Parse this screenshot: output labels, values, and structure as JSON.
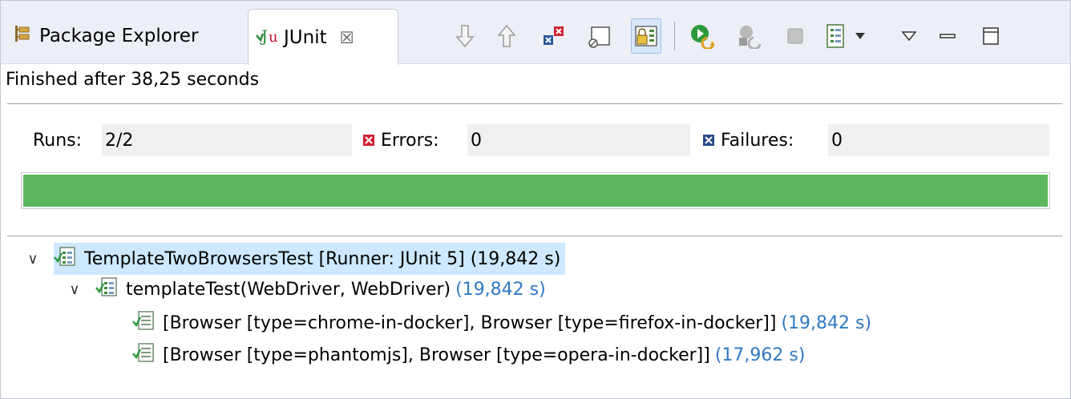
{
  "tabs": {
    "package_explorer": "Package Explorer",
    "junit": "JUnit"
  },
  "toolbar": {
    "icons": [
      "next-failure-icon",
      "previous-failure-icon",
      "show-failures-only-icon",
      "show-skipped-tests-only-icon",
      "scroll-lock-icon",
      "rerun-test-icon",
      "rerun-failed-first-icon",
      "stop-icon",
      "test-run-history-icon",
      "history-dropdown-icon",
      "view-menu-icon",
      "minimize-icon",
      "maximize-icon"
    ]
  },
  "status": {
    "message": "Finished after 38,25 seconds"
  },
  "counters": {
    "runs_label": "Runs:",
    "runs_value": "2/2",
    "errors_label": "Errors:",
    "errors_value": "0",
    "failures_label": "Failures:",
    "failures_value": "0"
  },
  "progress": {
    "fraction": 1.0,
    "color": "#5cb85c"
  },
  "tree": {
    "root": {
      "label": "TemplateTwoBrowsersTest [Runner: JUnit 5] (19,842 s)"
    },
    "method": {
      "label": "templateTest(WebDriver, WebDriver)",
      "time": "(19,842 s)"
    },
    "cases": [
      {
        "label": "[Browser [type=chrome-in-docker], Browser [type=firefox-in-docker]]",
        "time": "(19,842 s)"
      },
      {
        "label": "[Browser [type=phantomjs], Browser [type=opera-in-docker]]",
        "time": "(17,962 s)"
      }
    ]
  },
  "colors": {
    "selection": "#cde8ff",
    "time_text": "#2f79c4",
    "success": "#5cb85c"
  }
}
